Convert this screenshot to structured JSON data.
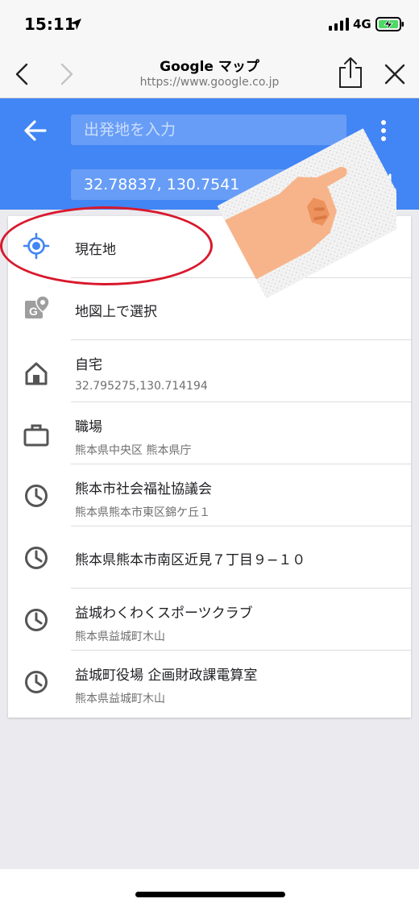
{
  "status_bar": {
    "time": "15:11",
    "network": "4G",
    "icons": [
      "location-arrow-icon",
      "signal-bars-icon",
      "battery-charging-icon"
    ]
  },
  "navbar": {
    "title": "Google マップ",
    "url": "https://www.google.co.jp",
    "icons": [
      "back-chevron-icon",
      "forward-chevron-icon",
      "share-icon",
      "close-icon"
    ]
  },
  "directions": {
    "origin_placeholder": "出発地を入力",
    "origin_value": "",
    "destination_value": "32.78837, 130.7541",
    "icons": [
      "back-arrow-icon",
      "more-vertical-icon",
      "swap-icon"
    ]
  },
  "suggestions": [
    {
      "icon": "my-location-icon",
      "title": "現在地",
      "subtitle": ""
    },
    {
      "icon": "map-pin-icon",
      "title": "地図上で選択",
      "subtitle": ""
    },
    {
      "icon": "home-icon",
      "title": "自宅",
      "subtitle": "32.795275,130.714194"
    },
    {
      "icon": "work-icon",
      "title": "職場",
      "subtitle": "熊本県中央区 熊本県庁"
    },
    {
      "icon": "history-icon",
      "title": "熊本市社会福祉協議会",
      "subtitle": "熊本県熊本市東区錦ケ丘１"
    },
    {
      "icon": "history-icon",
      "title": "熊本県熊本市南区近見７丁目９−１０",
      "subtitle": ""
    },
    {
      "icon": "history-icon",
      "title": "益城わくわくスポーツクラブ",
      "subtitle": "熊本県益城町木山"
    },
    {
      "icon": "history-icon",
      "title": "益城町役場 企画財政課電算室",
      "subtitle": "熊本県益城町木山"
    }
  ],
  "colors": {
    "header_blue": "#4285f4",
    "location_blue": "#4285f4",
    "annotation_red": "#d9182c"
  }
}
